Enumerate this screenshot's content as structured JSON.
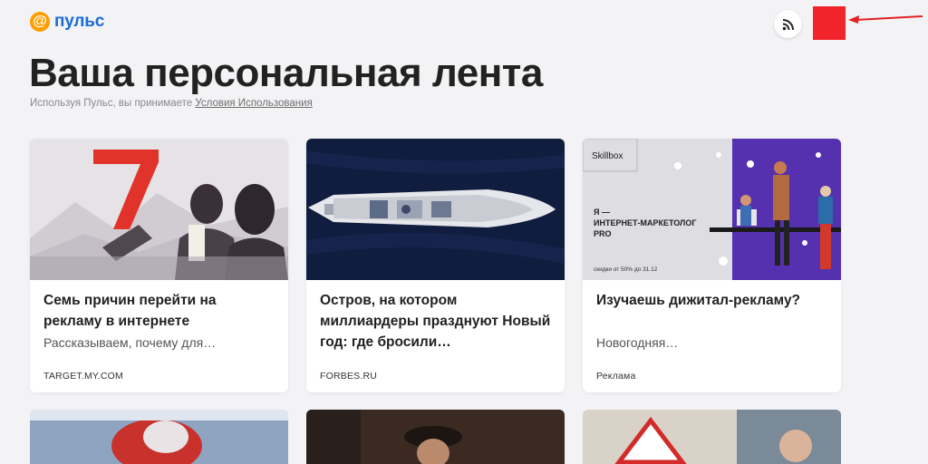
{
  "header": {
    "logo_symbol": "@",
    "logo_text": "пульс",
    "rss_icon": "rss-icon",
    "avatar_color": "#f2232b",
    "annotation_arrow_color": "#e32124"
  },
  "main": {
    "title": "Ваша персональная лента",
    "terms_prefix": "Используя Пульс, вы принимаете",
    "terms_link": "Условия Использования"
  },
  "cards": [
    {
      "title": "Семь причин перейти на рекламу в интернете",
      "description": "Рассказываем, почему для…",
      "source": "TARGET.MY.COM",
      "image_number": "7"
    },
    {
      "title": "Остров, на котором миллиардеры празднуют Новый год: где бросили…",
      "description": "",
      "source": "FORBES.RU"
    },
    {
      "title": "Изучаешь дижитал-рекламу?",
      "description": "Новогодняя…",
      "source": "Реклама",
      "ad_brand": "Skillbox",
      "ad_headline": "Я — ИНТЕРНЕТ-МАРКЕТОЛОГ PRO",
      "ad_discount": "скидки от 50% до 31.12"
    }
  ]
}
